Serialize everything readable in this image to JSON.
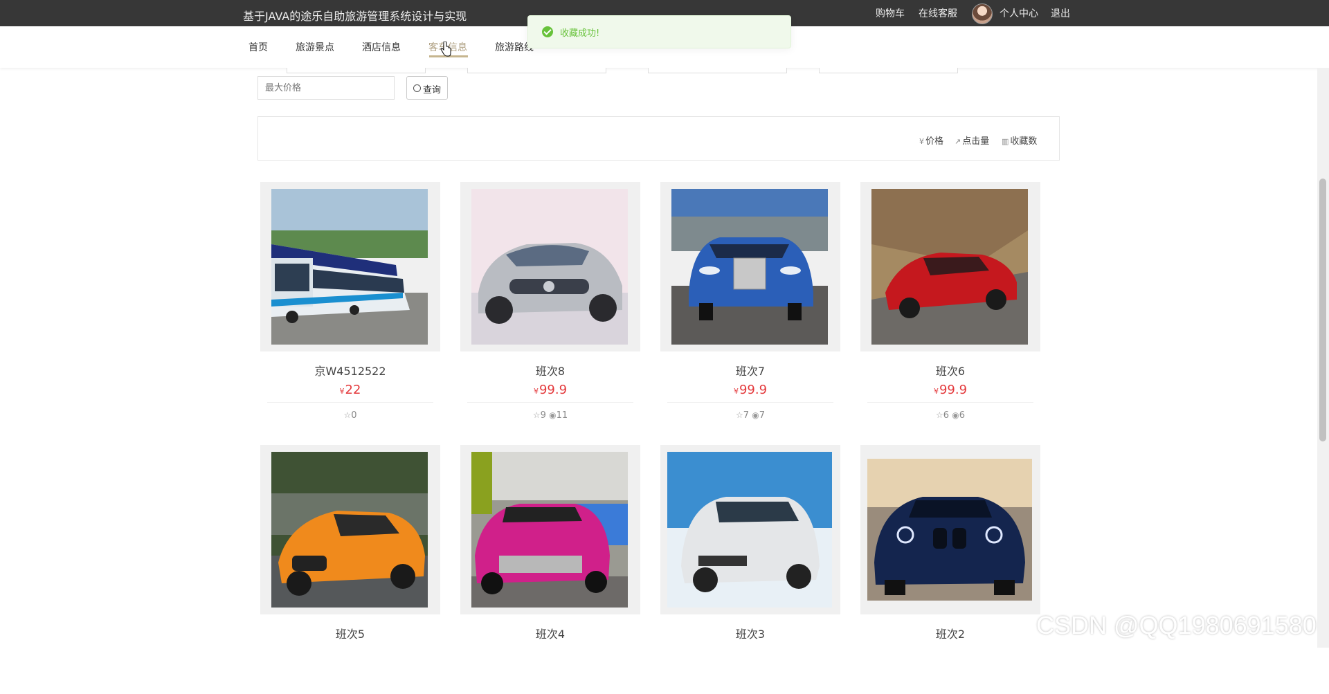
{
  "header": {
    "site_title": "基于JAVA的途乐自助旅游管理系统设计与实现",
    "links": {
      "cart": "购物车",
      "service": "在线客服",
      "profile": "个人中心",
      "logout": "退出"
    }
  },
  "nav": {
    "items": [
      "首页",
      "旅游景点",
      "酒店信息",
      "客车信息",
      "旅游路线"
    ],
    "active": "客车信息"
  },
  "toast": {
    "message": "收藏成功!"
  },
  "filter": {
    "max_price_placeholder": "最大价格",
    "query_label": "查询"
  },
  "sort": {
    "price": "价格",
    "clicks": "点击量",
    "favorites": "收藏数"
  },
  "currency": "¥",
  "cards": [
    {
      "name": "京W4512522",
      "price": "22",
      "fav": "0",
      "views": "",
      "image": "bus-fleet"
    },
    {
      "name": "班次8",
      "price": "99.9",
      "fav": "9",
      "views": "11",
      "image": "silver-concept-suv"
    },
    {
      "name": "班次7",
      "price": "99.9",
      "fav": "7",
      "views": "7",
      "image": "blue-rolls-royce"
    },
    {
      "name": "班次6",
      "price": "99.9",
      "fav": "6",
      "views": "6",
      "image": "red-hatchback"
    },
    {
      "name": "班次5",
      "price": "",
      "fav": "",
      "views": "",
      "image": "orange-audi-tt"
    },
    {
      "name": "班次4",
      "price": "",
      "fav": "",
      "views": "",
      "image": "pink-subaru"
    },
    {
      "name": "班次3",
      "price": "",
      "fav": "",
      "views": "",
      "image": "white-suzuki-snow"
    },
    {
      "name": "班次2",
      "price": "",
      "fav": "",
      "views": "",
      "image": "blue-bmw"
    }
  ],
  "watermark": "CSDN @QQ1980691580",
  "colors": {
    "accent": "#b0a183",
    "price": "#e4393c",
    "topbar": "#373737",
    "toast_green": "#67c23a"
  }
}
